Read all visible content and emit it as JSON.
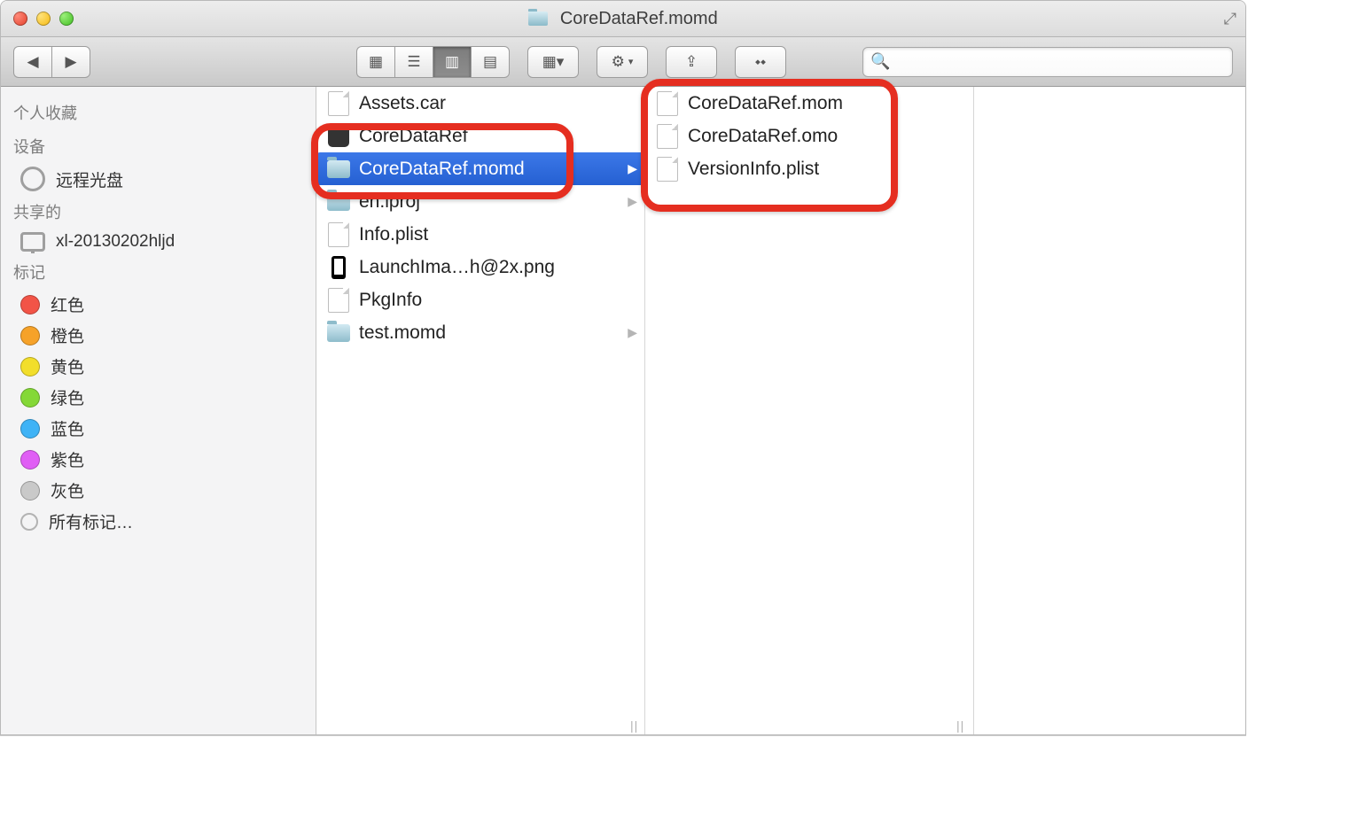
{
  "window": {
    "title": "CoreDataRef.momd"
  },
  "sidebar": {
    "sections": {
      "favorites": {
        "title": "个人收藏"
      },
      "devices": {
        "title": "设备",
        "items": [
          "远程光盘"
        ]
      },
      "shared": {
        "title": "共享的",
        "items": [
          "xl-20130202hljd"
        ]
      },
      "tags": {
        "title": "标记",
        "items": [
          "红色",
          "橙色",
          "黄色",
          "绿色",
          "蓝色",
          "紫色",
          "灰色",
          "所有标记…"
        ]
      }
    }
  },
  "columns": {
    "middle": {
      "items": [
        {
          "name": "Assets.car",
          "type": "file"
        },
        {
          "name": "CoreDataRef",
          "type": "app"
        },
        {
          "name": "CoreDataRef.momd",
          "type": "folder",
          "selected": true,
          "hasChildren": true
        },
        {
          "name": "en.lproj",
          "type": "folder",
          "hasChildren": true
        },
        {
          "name": "Info.plist",
          "type": "file"
        },
        {
          "name": "LaunchIma…h@2x.png",
          "type": "iphone"
        },
        {
          "name": "PkgInfo",
          "type": "file"
        },
        {
          "name": "test.momd",
          "type": "folder",
          "hasChildren": true
        }
      ]
    },
    "right": {
      "items": [
        {
          "name": "CoreDataRef.mom",
          "type": "file"
        },
        {
          "name": "CoreDataRef.omo",
          "type": "file"
        },
        {
          "name": "VersionInfo.plist",
          "type": "file"
        }
      ]
    }
  },
  "search": {
    "placeholder": ""
  }
}
